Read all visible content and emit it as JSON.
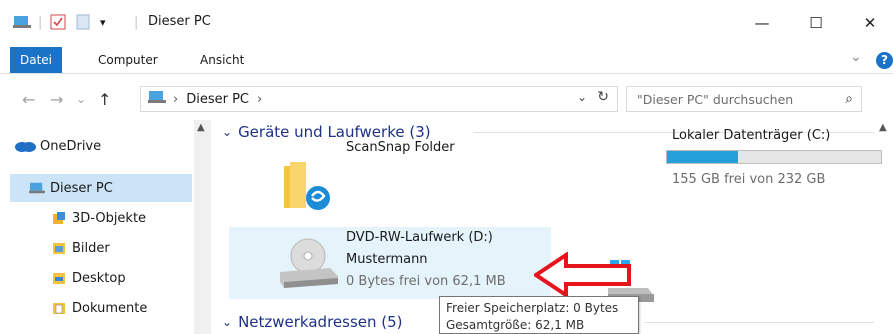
{
  "window": {
    "title": "Dieser PC",
    "controls": {
      "minimize": "—",
      "maximize": "☐",
      "close": "✕"
    }
  },
  "ribbon": {
    "tabs": [
      "Datei",
      "Computer",
      "Ansicht"
    ],
    "expand": "⌄",
    "help": "?"
  },
  "nav": {
    "back": "←",
    "forward": "→",
    "recent": "⌄",
    "up": "↑",
    "breadcrumb": [
      "Dieser PC"
    ],
    "separator": "›",
    "dropdown": "⌄",
    "refresh": "↻",
    "search_placeholder": "\"Dieser PC\" durchsuchen",
    "search_icon": "⌕"
  },
  "sidebar": {
    "items": [
      {
        "label": "OneDrive",
        "icon": "cloud-icon"
      },
      {
        "label": "Dieser PC",
        "icon": "computer-icon",
        "selected": true
      },
      {
        "label": "3D-Objekte",
        "icon": "cube-icon"
      },
      {
        "label": "Bilder",
        "icon": "pictures-folder-icon"
      },
      {
        "label": "Desktop",
        "icon": "desktop-folder-icon"
      },
      {
        "label": "Dokumente",
        "icon": "documents-folder-icon"
      }
    ]
  },
  "content": {
    "group1": {
      "label": "Geräte und Laufwerke (3)"
    },
    "group2": {
      "label": "Netzwerkadressen (5)"
    },
    "items": {
      "scansnap": {
        "title": "ScanSnap Folder",
        "icon": "scansnap-folder-icon"
      },
      "c_drive": {
        "title": "Lokaler Datenträger (C:)",
        "sub": "155 GB frei von 232 GB",
        "icon": "windows-drive-icon",
        "used_fraction": 0.332
      },
      "dvd": {
        "title": "DVD-RW-Laufwerk (D:)",
        "label": "Mustermann",
        "sub": "0 Bytes frei von 62,1 MB",
        "icon": "dvd-drive-icon"
      }
    }
  },
  "tooltip": {
    "line1": "Freier Speicherplatz: 0 Bytes",
    "line2": "Gesamtgröße: 62,1 MB"
  },
  "colors": {
    "accent": "#1a73c7",
    "group_header": "#1e3287",
    "selection": "#cce4f7",
    "hover": "#e5f3fb",
    "progress": "#26a0da",
    "arrow": "#e8141b"
  }
}
